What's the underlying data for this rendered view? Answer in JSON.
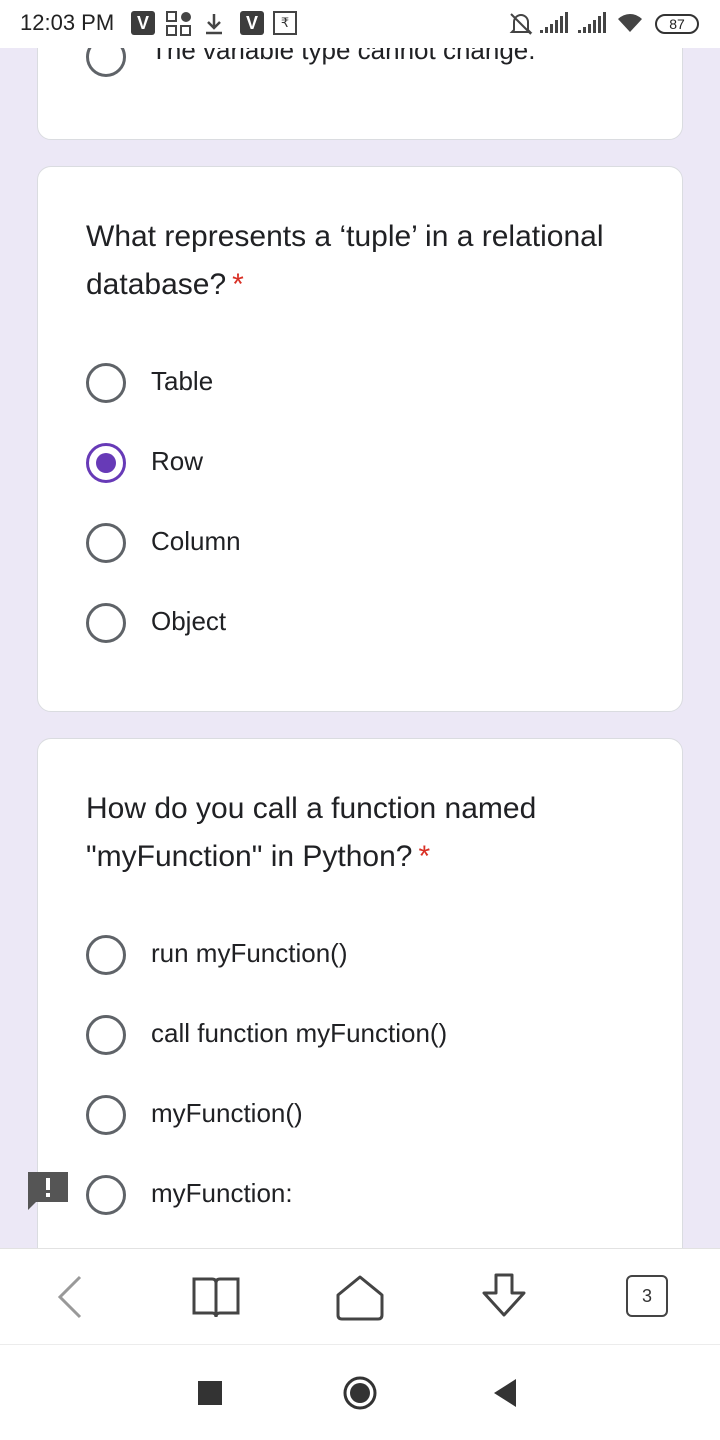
{
  "status_bar": {
    "time": "12:03 PM",
    "v_badge": "V",
    "rupee_badge": "₹",
    "battery": "87",
    "icons": [
      "v-app-icon",
      "app-grid-icon",
      "download-icon",
      "rupee-icon",
      "mute-bell-icon",
      "signal-icon",
      "signal-icon",
      "wifi-icon",
      "battery-icon"
    ]
  },
  "form": {
    "accent_color": "#673ab7",
    "required_color": "#d93025",
    "previous_option_text": "The variable type cannot change.",
    "questions": [
      {
        "title": "What represents a ‘tuple’ in a relational database?",
        "required_mark": "*",
        "options": [
          "Table",
          "Row",
          "Column",
          "Object"
        ],
        "selected": "Row"
      },
      {
        "title": "How do you call a function named \"myFunction\" in Python?",
        "required_mark": "*",
        "options": [
          "run myFunction()",
          "call function myFunction()",
          "myFunction()",
          "myFunction:"
        ],
        "selected": null
      }
    ]
  },
  "toolbar": {
    "tab_count": "3",
    "icons": [
      "back-icon",
      "book-icon",
      "home-icon",
      "download-arrow-icon",
      "tabs-icon"
    ]
  },
  "nav_bar": {
    "icons": [
      "recents-square-icon",
      "home-circle-icon",
      "back-triangle-icon"
    ]
  }
}
